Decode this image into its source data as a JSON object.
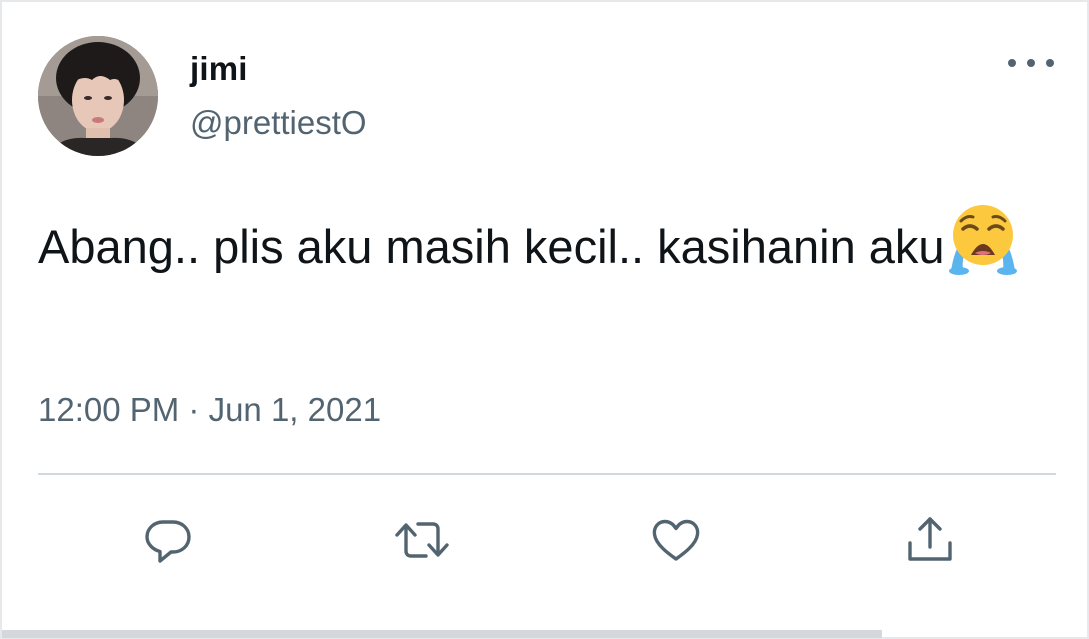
{
  "tweet": {
    "author_name": "jimi",
    "author_handle": "@prettiestO",
    "text": "Abang.. plis aku masih kecil.. kasihanin aku",
    "emoji": "loudly-crying-face",
    "timestamp": "12:00 PM · Jun 1, 2021"
  },
  "icons": {
    "more": "more-horizontal-icon",
    "reply": "reply-icon",
    "retweet": "retweet-icon",
    "like": "heart-icon",
    "share": "share-icon"
  },
  "colors": {
    "text_primary": "#0f1419",
    "text_secondary": "#536471",
    "divider": "#cfd9de",
    "background": "#ffffff"
  }
}
